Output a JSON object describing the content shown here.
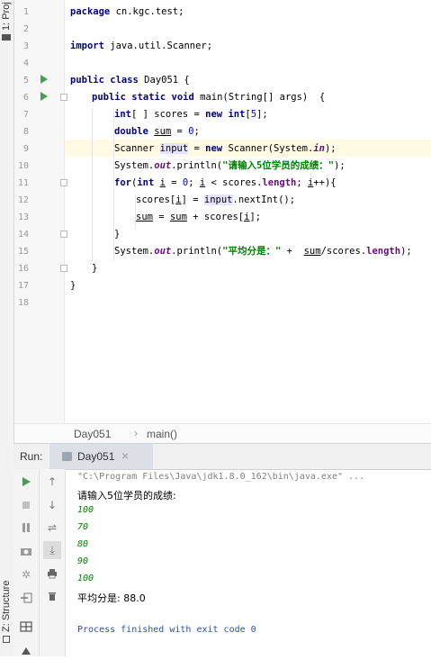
{
  "side_tabs": {
    "project": "1: Proj",
    "structure": "Z: Structure"
  },
  "line_numbers": [
    "1",
    "2",
    "3",
    "4",
    "5",
    "6",
    "7",
    "8",
    "9",
    "10",
    "11",
    "12",
    "13",
    "14",
    "15",
    "16",
    "17",
    "18"
  ],
  "code": {
    "l1": {
      "kw": "package",
      "rest": " cn.kgc.test;"
    },
    "l3": {
      "kw": "import",
      "rest": " java.util.Scanner;"
    },
    "l5": {
      "kw": "public class",
      "rest": " Day051 {"
    },
    "l6": {
      "kw": "public static void",
      "rest": " main(String[] args)  {"
    },
    "l7": {
      "kw1": "int",
      "mid": "[ ] scores = ",
      "kw2": "new",
      "sp": " ",
      "kw3": "int",
      "b1": "[",
      "num": "5",
      "b2": "];"
    },
    "l8": {
      "kw": "double",
      "sp": " ",
      "var": "sum",
      "mid": " = ",
      "num": "0",
      "end": ";"
    },
    "l9": {
      "a": "Scanner ",
      "var": "input",
      "b": " = ",
      "kw": "new",
      "c": " Scanner(System.",
      "fld": "in",
      "d": ");"
    },
    "l10": {
      "a": "System.",
      "fld": "out",
      "b": ".println(",
      "str": "\"请输入5位学员的成绩：\"",
      "c": ");"
    },
    "l11": {
      "kw1": "for",
      "a": "(",
      "kw2": "int",
      "sp": " ",
      "v1": "i",
      "b": " = ",
      "num": "0",
      "c": "; ",
      "v2": "i",
      "d": " < scores.",
      "fld": "length",
      "e": "; ",
      "v3": "i",
      "f": "++){"
    },
    "l12": {
      "a": "scores[",
      "v": "i",
      "b": "] = ",
      "inp": "input",
      "c": ".nextInt();"
    },
    "l13": {
      "v1": "sum",
      "a": " = ",
      "v2": "sum",
      "b": " + scores[",
      "v3": "i",
      "c": "];"
    },
    "l14": "}",
    "l15": {
      "a": "System.",
      "fld": "out",
      "b": ".println(",
      "str": "\"平均分是：\"",
      "c": " +  ",
      "v": "sum",
      "d": "/scores.",
      "fld2": "length",
      "e": ");"
    },
    "l16": "}",
    "l17": "}"
  },
  "breadcrumb": {
    "cls": "Day051",
    "sep": "›",
    "method": "main()"
  },
  "run_panel": {
    "label": "Run:",
    "tab": "Day051",
    "close": "×"
  },
  "console": {
    "cmd": "\"C:\\Program Files\\Java\\jdk1.8.0_162\\bin\\java.exe\" ...",
    "prompt": "请输入5位学员的成绩:",
    "inputs": [
      "100",
      "70",
      "80",
      "90",
      "100"
    ],
    "result": "平均分是: 88.0",
    "exit": "Process finished with exit code 0"
  },
  "colors": {
    "keyword": "#000080",
    "string": "#008000",
    "field": "#660e7a",
    "number": "#0000ff",
    "run_green": "#499c54"
  }
}
